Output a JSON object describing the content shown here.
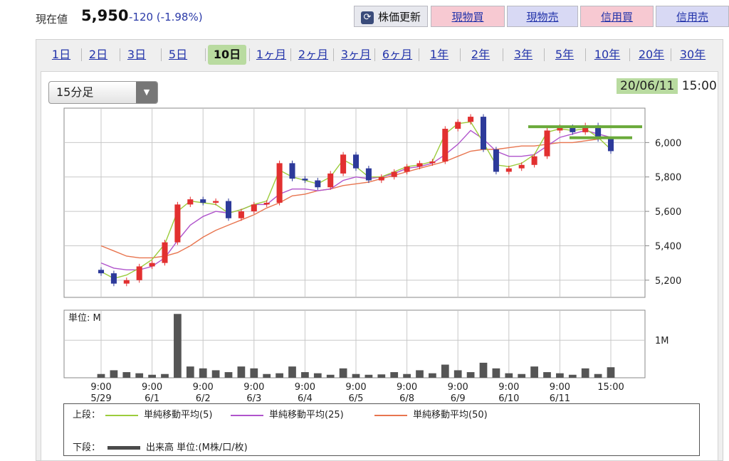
{
  "header": {
    "label": "現在値",
    "price": "5,950",
    "change": "-120 (-1.98%)",
    "buttons": {
      "update": "株価更新",
      "buy_cash": "現物買",
      "sell_cash": "現物売",
      "buy_margin": "信用買",
      "sell_margin": "信用売"
    }
  },
  "tabs": [
    "1日",
    "2日",
    "3日",
    "5日",
    "10日",
    "1ヶ月",
    "2ヶ月",
    "3ヶ月",
    "6ヶ月",
    "1年",
    "2年",
    "3年",
    "5年",
    "10年",
    "20年",
    "30年"
  ],
  "active_tab": "10日",
  "interval": {
    "selected": "15分足"
  },
  "datetime": {
    "date": "20/06/11",
    "time": "15:00"
  },
  "colors": {
    "sma5": "#9ccc3c",
    "sma25": "#b054cc",
    "sma50": "#e8754f",
    "candle_up": "#e23030",
    "candle_down": "#2d3a9a",
    "volume": "#555555",
    "highlight": "#6aaa3a"
  },
  "legend": {
    "upper": "上段：",
    "sma5": "単純移動平均(5)",
    "sma25": "単純移動平均(25)",
    "sma50": "単純移動平均(50)",
    "lower": "下段：",
    "volume": "出来高 単位:(M株/口/枚)"
  },
  "chart_data": [
    {
      "type": "line",
      "panel": "price",
      "ylim": [
        5100,
        6200
      ],
      "yticks": [
        "6,000",
        "5,800",
        "5,600",
        "5,400",
        "5,200"
      ],
      "ytick_values": [
        6000,
        5800,
        5600,
        5400,
        5200
      ],
      "x_ticks": [
        {
          "time": "9:00",
          "date": "5/29"
        },
        {
          "time": "9:00",
          "date": "6/1"
        },
        {
          "time": "9:00",
          "date": "6/2"
        },
        {
          "time": "9:00",
          "date": "6/3"
        },
        {
          "time": "9:00",
          "date": "6/4"
        },
        {
          "time": "9:00",
          "date": "6/5"
        },
        {
          "time": "9:00",
          "date": "6/8"
        },
        {
          "time": "9:00",
          "date": "6/9"
        },
        {
          "time": "9:00",
          "date": "6/10"
        },
        {
          "time": "9:00",
          "date": "6/11"
        },
        {
          "time": "15:00",
          "date": ""
        }
      ],
      "close": [
        5240,
        5180,
        5200,
        5280,
        5300,
        5420,
        5640,
        5670,
        5650,
        5660,
        5560,
        5600,
        5640,
        5650,
        5880,
        5790,
        5780,
        5740,
        5820,
        5930,
        5850,
        5780,
        5800,
        5830,
        5860,
        5880,
        5890,
        6080,
        6120,
        6150,
        5960,
        5830,
        5850,
        5870,
        5920,
        6070,
        6090,
        6060,
        6100,
        6020,
        5950
      ],
      "sma5": [
        5250,
        5210,
        5230,
        5270,
        5320,
        5410,
        5600,
        5660,
        5650,
        5640,
        5590,
        5610,
        5640,
        5660,
        5840,
        5800,
        5780,
        5760,
        5800,
        5900,
        5860,
        5800,
        5800,
        5830,
        5860,
        5870,
        5890,
        6050,
        6110,
        6120,
        6000,
        5870,
        5860,
        5880,
        5930,
        6060,
        6080,
        6070,
        6080,
        6030,
        5960
      ],
      "sma25": [
        5300,
        5270,
        5260,
        5260,
        5280,
        5330,
        5430,
        5520,
        5570,
        5600,
        5590,
        5610,
        5640,
        5640,
        5700,
        5730,
        5730,
        5720,
        5730,
        5780,
        5800,
        5790,
        5800,
        5820,
        5850,
        5860,
        5880,
        5930,
        5990,
        6070,
        6020,
        5950,
        5920,
        5920,
        5930,
        5980,
        6030,
        6050,
        6070,
        6050,
        6030
      ],
      "sma50": [
        5400,
        5370,
        5340,
        5330,
        5330,
        5340,
        5360,
        5400,
        5450,
        5490,
        5520,
        5550,
        5580,
        5620,
        5650,
        5690,
        5700,
        5720,
        5730,
        5750,
        5760,
        5770,
        5790,
        5810,
        5830,
        5850,
        5870,
        5890,
        5920,
        5950,
        5960,
        5960,
        5970,
        5980,
        5980,
        5990,
        6000,
        6000,
        6010,
        6020,
        6030
      ]
    },
    {
      "type": "bar",
      "panel": "volume",
      "ylabel": "単位: M",
      "yticks": [
        "1M"
      ],
      "ylim": [
        0,
        1.8
      ],
      "values": [
        0.1,
        0.2,
        0.15,
        0.12,
        0.08,
        0.1,
        1.7,
        0.3,
        0.25,
        0.2,
        0.15,
        0.3,
        0.25,
        0.1,
        0.12,
        0.3,
        0.15,
        0.12,
        0.08,
        0.25,
        0.1,
        0.08,
        0.09,
        0.15,
        0.1,
        0.2,
        0.12,
        0.35,
        0.2,
        0.15,
        0.4,
        0.25,
        0.12,
        0.1,
        0.3,
        0.15,
        0.12,
        0.08,
        0.25,
        0.1,
        0.28
      ]
    }
  ]
}
